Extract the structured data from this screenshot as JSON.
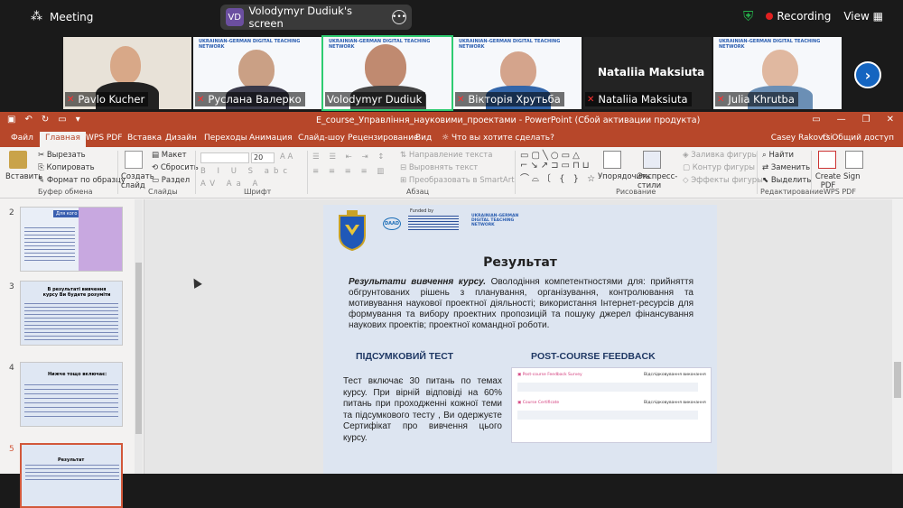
{
  "zoom": {
    "app_label": "Meeting",
    "share_initials": "VD",
    "share_label": "Volodymyr Dudiuk's screen",
    "recording_label": "Recording",
    "view_label": "View",
    "participants": [
      {
        "name": "Pavlo Kucher"
      },
      {
        "name": "Руслана Валерко"
      },
      {
        "name": "Volodymyr Dudiuk"
      },
      {
        "name": "Вікторія Хрутьба"
      },
      {
        "name": "Nataliia Maksiuta",
        "big_name": "Nataliia Maksiuta"
      },
      {
        "name": "Julia Khrutba"
      }
    ],
    "banner_text": "UKRAINIAN-GERMAN DIGITAL TEACHING NETWORK"
  },
  "ppt": {
    "window_title": "E_course_Управління_науковими_проектами - PowerPoint (Сбой активации продукта)",
    "tabs": [
      "Файл",
      "Главная",
      "WPS PDF",
      "Вставка",
      "Дизайн",
      "Переходы",
      "Анимация",
      "Слайд-шоу",
      "Рецензирование",
      "Вид",
      "Что вы хотите сделать?"
    ],
    "account": "Casey Rakovtsi",
    "share": "Общий доступ",
    "ribbon": {
      "paste": "Вставить",
      "cut": "Вырезать",
      "copy": "Копировать",
      "format_painter": "Формат по образцу",
      "clipboard_group": "Буфер обмена",
      "new_slide": "Создать слайд",
      "layout": "Макет",
      "reset": "Сбросить",
      "section": "Раздел",
      "slides_group": "Слайды",
      "font_size": "20",
      "font_group": "Шрифт",
      "text_direction": "Направление текста",
      "align_text": "Выровнять текст",
      "smartart": "Преобразовать в SmartArt",
      "paragraph_group": "Абзац",
      "arrange": "Упорядочить",
      "quick_styles": "Экспресс-стили",
      "shape_fill": "Заливка фигуры",
      "shape_outline": "Контур фигуры",
      "shape_effects": "Эффекты фигуры",
      "drawing_group": "Рисование",
      "find": "Найти",
      "replace": "Заменить",
      "select": "Выделить",
      "editing_group": "Редактирование",
      "create_pdf": "Create PDF",
      "sign": "Sign",
      "wps_group": "WPS PDF"
    },
    "thumbnails": [
      {
        "num": "2",
        "title": "Для кого цей курс"
      },
      {
        "num": "3",
        "title": "В результаті вивчення курсу Ви будете розуміти"
      },
      {
        "num": "4",
        "title": "Нижче тощо включає:"
      },
      {
        "num": "5",
        "title": "Результат"
      }
    ],
    "slide": {
      "funded": "Funded by",
      "daad": "DAAD",
      "title": "Результат",
      "lead_italic": "Результати вивчення курсу.",
      "paragraph": " Оволодіння компетентностями для: прийняття обгрунтованих рішень з планування, організування, контролювання та мотивування наукової проектної діяльності; використання Інтернет-ресурсів для формування та вибору проектних пропозицій та пошуку джерел фінансування наукових проектів; проектної командної роботи.",
      "test_heading": "ПІДСУМКОВИЙ ТЕСТ",
      "feedback_heading": "POST-COURSE FEEDBACK",
      "test_text": "Тест включає 30 питань по темах курсу. При вірній відповіді на 60% питань при проходженні кожної теми та підсумкового тесту , Ви одержуєте Сертифікат про вивчення цього курсу.",
      "fb_item1": "Post-course Feedback Survey",
      "fb_item2": "Course Certificate",
      "fb_status": "Відслідковування виконання"
    }
  }
}
